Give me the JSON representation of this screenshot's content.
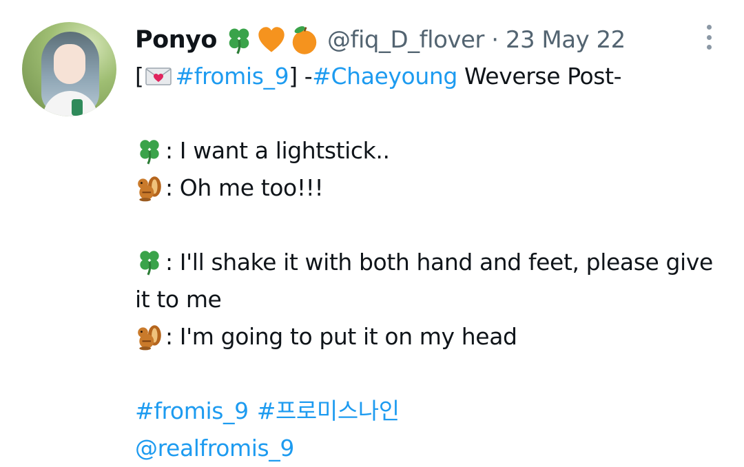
{
  "tweet": {
    "author": {
      "name": "Ponyo",
      "name_emoji": [
        "four-leaf-clover",
        "orange-heart",
        "tangerine"
      ],
      "handle": "@fiq_D_flover",
      "separator": "·",
      "date": "23 May 22"
    },
    "lines": [
      {
        "prefix_open": "[",
        "icon": "love-letter",
        "tag": "#fromis_9",
        "prefix_close": "] -",
        "tag2": "#Chaeyoung",
        "rest": " Weverse Post-"
      },
      {
        "icon": "four-leaf-clover",
        "text": ": I want a lightstick.."
      },
      {
        "icon": "chipmunk",
        "text": ": Oh me too!!!"
      },
      {
        "icon": "four-leaf-clover",
        "text": ": I'll shake it with both hand and feet, please give it to me"
      },
      {
        "icon": "chipmunk",
        "text": ": I'm going to put it on my head"
      }
    ],
    "hashtags": [
      "#fromis_9",
      "#프로미스나인"
    ],
    "mention": "@realfromis_9"
  },
  "colors": {
    "text": "#0f1419",
    "muted": "#536471",
    "link": "#1d9bf0",
    "clover": "#3aa34a",
    "orange": "#f5931e"
  },
  "icons": {
    "more": "more-vertical-icon",
    "avatar": "profile-avatar"
  }
}
